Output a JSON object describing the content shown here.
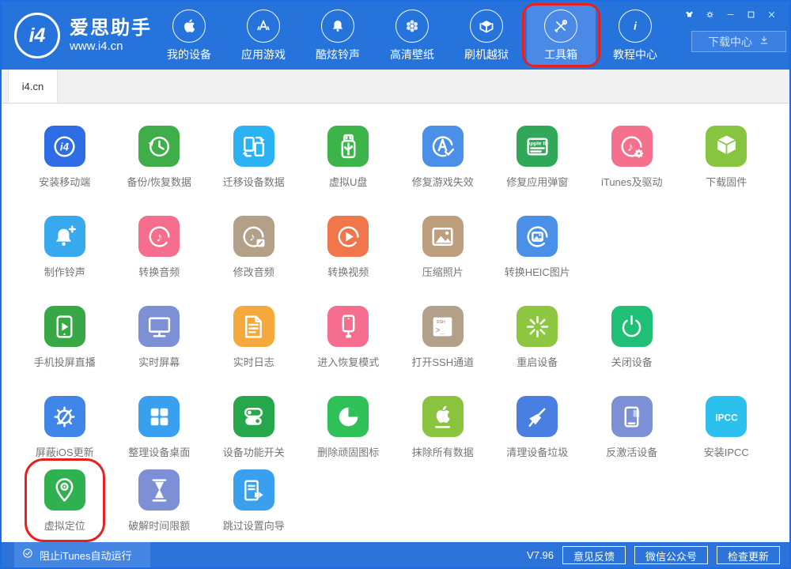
{
  "window": {
    "border_color": "#1c6ce2",
    "annotation_color": "#e8211f"
  },
  "header": {
    "logo": {
      "badge": "i4",
      "title": "爱思助手",
      "url": "www.i4.cn"
    },
    "nav": [
      {
        "name": "my-devices",
        "label": "我的设备",
        "active": false
      },
      {
        "name": "apps-games",
        "label": "应用游戏",
        "active": false
      },
      {
        "name": "ringtones",
        "label": "酷炫铃声",
        "active": false
      },
      {
        "name": "wallpapers",
        "label": "高清壁纸",
        "active": false
      },
      {
        "name": "flash-jailbreak",
        "label": "刷机越狱",
        "active": false
      },
      {
        "name": "toolbox",
        "label": "工具箱",
        "active": true,
        "annotated": true
      },
      {
        "name": "tutorials",
        "label": "教程中心",
        "active": false
      }
    ],
    "window_controls": [
      {
        "name": "theme"
      },
      {
        "name": "settings"
      },
      {
        "name": "minimize"
      },
      {
        "name": "maximize"
      },
      {
        "name": "close"
      }
    ],
    "download_button": {
      "label": "下载中心"
    }
  },
  "tabs": [
    {
      "label": "i4.cn",
      "active": true
    }
  ],
  "grid": {
    "rows": [
      [
        {
          "name": "install-mobile",
          "label": "安装移动端",
          "color": "#2e6de4"
        },
        {
          "name": "backup-restore",
          "label": "备份/恢复数据",
          "color": "#3fae49"
        },
        {
          "name": "migrate-data",
          "label": "迁移设备数据",
          "color": "#2ab2f2"
        },
        {
          "name": "virtual-usb",
          "label": "虚拟U盘",
          "color": "#3cb44a"
        },
        {
          "name": "fix-games",
          "label": "修复游戏失效",
          "color": "#4a90e8"
        },
        {
          "name": "fix-appid-popup",
          "label": "修复应用弹窗",
          "color": "#2fa857"
        },
        {
          "name": "itunes-driver",
          "label": "iTunes及驱动",
          "color": "#f4708d"
        },
        {
          "name": "download-firmware",
          "label": "下载固件",
          "color": "#87c540"
        }
      ],
      [
        {
          "name": "make-ringtone",
          "label": "制作铃声",
          "color": "#38a9ee"
        },
        {
          "name": "convert-audio",
          "label": "转换音频",
          "color": "#f56e8d"
        },
        {
          "name": "edit-audio",
          "label": "修改音频",
          "color": "#b3a089"
        },
        {
          "name": "convert-video",
          "label": "转换视频",
          "color": "#f1764b"
        },
        {
          "name": "compress-photos",
          "label": "压缩照片",
          "color": "#bd9e7d"
        },
        {
          "name": "convert-heic",
          "label": "转换HEIC图片",
          "color": "#4a90e8"
        }
      ],
      [
        {
          "name": "screen-mirror-live",
          "label": "手机投屏直播",
          "color": "#37a845"
        },
        {
          "name": "realtime-screen",
          "label": "实时屏幕",
          "color": "#7d90d5"
        },
        {
          "name": "realtime-log",
          "label": "实时日志",
          "color": "#f5a93c"
        },
        {
          "name": "enter-recovery",
          "label": "进入恢复模式",
          "color": "#f56e8d"
        },
        {
          "name": "open-ssh",
          "label": "打开SSH通道",
          "color": "#b3a089"
        },
        {
          "name": "reboot-device",
          "label": "重启设备",
          "color": "#8dc63f"
        },
        {
          "name": "shutdown-device",
          "label": "关闭设备",
          "color": "#1fbf75"
        }
      ],
      [
        {
          "name": "block-ios-update",
          "label": "屏蔽iOS更新",
          "color": "#3f86e8"
        },
        {
          "name": "organize-homescreen",
          "label": "整理设备桌面",
          "color": "#38a0ee"
        },
        {
          "name": "device-switches",
          "label": "设备功能开关",
          "color": "#27a74b"
        },
        {
          "name": "remove-stubborn-icons",
          "label": "删除顽固图标",
          "color": "#2fc058"
        },
        {
          "name": "erase-all-data",
          "label": "抹除所有数据",
          "color": "#8ac43f"
        },
        {
          "name": "clean-junk",
          "label": "清理设备垃圾",
          "color": "#4a7fe2"
        },
        {
          "name": "deactivate-device",
          "label": "反激活设备",
          "color": "#7d90d5"
        },
        {
          "name": "install-ipcc",
          "label": "安装IPCC",
          "color": "#2cc0ee"
        }
      ],
      [
        {
          "name": "virtual-location",
          "label": "虚拟定位",
          "color": "#2eb14e",
          "annotated": true
        },
        {
          "name": "crack-time-limit",
          "label": "破解时间限额",
          "color": "#7d90d5"
        },
        {
          "name": "skip-setup-wizard",
          "label": "跳过设置向导",
          "color": "#38a0ee"
        }
      ]
    ]
  },
  "statusbar": {
    "checkbox_label": "阻止iTunes自动运行",
    "version": "V7.96",
    "buttons": [
      "意见反馈",
      "微信公众号",
      "检查更新"
    ]
  }
}
